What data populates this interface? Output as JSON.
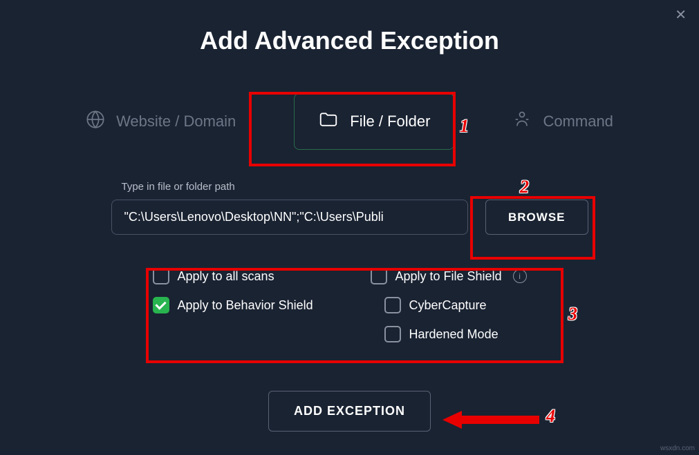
{
  "title": "Add Advanced Exception",
  "tabs": {
    "website": "Website / Domain",
    "file": "File / Folder",
    "command": "Command"
  },
  "path": {
    "label": "Type in file or folder path",
    "value": "\"C:\\Users\\Lenovo\\Desktop\\NN\";\"C:\\Users\\Publi",
    "browse": "BROWSE"
  },
  "options": {
    "all_scans": "Apply to all scans",
    "file_shield": "Apply to File Shield",
    "behavior_shield": "Apply to Behavior Shield",
    "cyber_capture": "CyberCapture",
    "hardened_mode": "Hardened Mode"
  },
  "add_button": "ADD EXCEPTION",
  "annotations": {
    "n1": "1",
    "n2": "2",
    "n3": "3",
    "n4": "4"
  },
  "watermark": "wsxdn.com"
}
